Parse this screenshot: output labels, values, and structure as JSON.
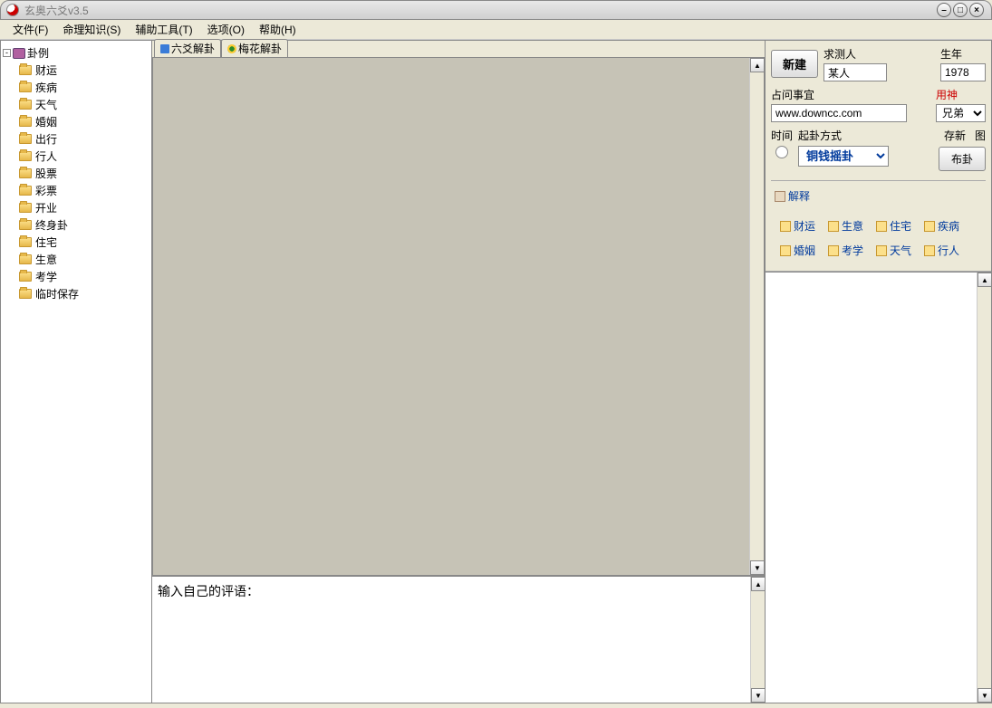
{
  "window": {
    "title": "玄奥六爻v3.5"
  },
  "menu": {
    "file": "文件(F)",
    "knowledge": "命理知识(S)",
    "tools": "辅助工具(T)",
    "options": "选项(O)",
    "help": "帮助(H)"
  },
  "tree": {
    "root": "卦例",
    "items": [
      "财运",
      "疾病",
      "天气",
      "婚姻",
      "出行",
      "行人",
      "股票",
      "彩票",
      "开业",
      "终身卦",
      "住宅",
      "生意",
      "考学",
      "临时保存"
    ]
  },
  "tabs": {
    "liuyao": "六爻解卦",
    "meihua": "梅花解卦"
  },
  "comment": {
    "prompt": "输入自己的评语："
  },
  "form": {
    "new_btn": "新建",
    "person_label": "求测人",
    "person_value": "某人",
    "year_label": "生年",
    "year_value": "1978",
    "subject_label": "占问事宜",
    "subject_value": "www.downcc.com",
    "yongshen_label": "用神",
    "yongshen_value": "兄弟",
    "time_label": "时间",
    "method_label": "起卦方式",
    "method_value": "铜钱摇卦",
    "save_label": "存新",
    "tu_label": "图",
    "bugua_btn": "布卦"
  },
  "links": {
    "explain": "解释",
    "row1": [
      "财运",
      "生意",
      "住宅",
      "疾病"
    ],
    "row2": [
      "婚姻",
      "考学",
      "天气",
      "行人"
    ]
  }
}
